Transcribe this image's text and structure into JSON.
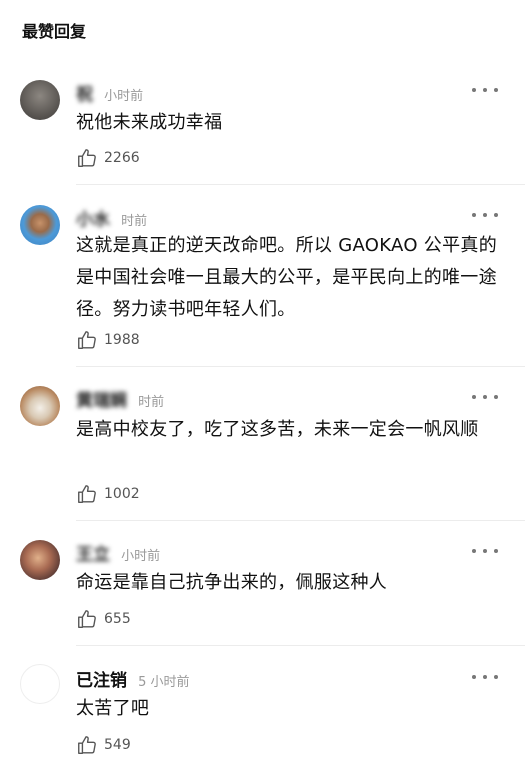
{
  "section": {
    "title": "最赞回复"
  },
  "comments": [
    {
      "username": "祝",
      "time": "小时前",
      "text": "祝他未来成功幸福",
      "likes": "2266",
      "avatar_color": "#6e6a66"
    },
    {
      "username": "小水",
      "time": "时前",
      "text": "这就是真正的逆天改命吧。所以 GAOKAO 公平真的是中国社会唯一且最大的公平，是平民向上的唯一途径。努力读书吧年轻人们。",
      "likes": "1988",
      "avatar_color": "#4d9ad8"
    },
    {
      "username": "黄瑞娴",
      "time": "时前",
      "text": "是高中校友了，吃了这多苦，未来一定会一帆风顺",
      "likes": "1002",
      "avatar_color": "#b98a62"
    },
    {
      "username": "王立",
      "time": "小时前",
      "text": "命运是靠自己抗争出来的，佩服这种人",
      "likes": "655",
      "avatar_color": "#8a5a4a"
    },
    {
      "username": "已注销",
      "time": "5 小时前",
      "text": "太苦了吧",
      "likes": "549",
      "avatar_color": "#ffffff"
    }
  ]
}
